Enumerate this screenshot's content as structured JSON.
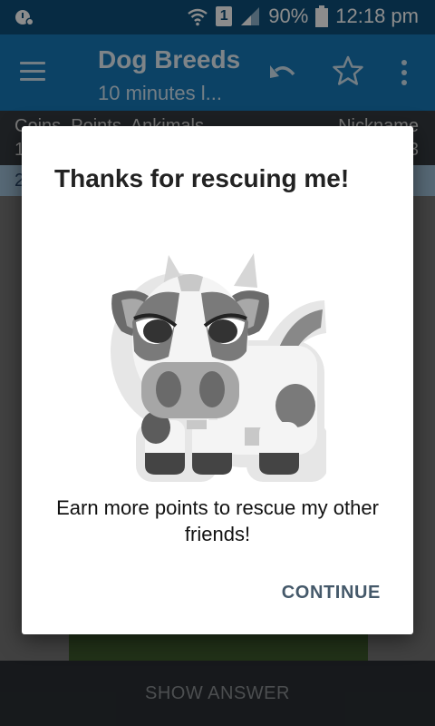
{
  "status_bar": {
    "battery": "90%",
    "time": "12:18 pm",
    "sim_badge": "1"
  },
  "app_bar": {
    "title": "Dog Breeds",
    "subtitle": "10 minutes l..."
  },
  "info_strip": {
    "left_line1": "Coins, Points, Ankimals",
    "left_line2": "1",
    "right_line1": "Nickname",
    "right_line2": "3"
  },
  "row_strip": {
    "text": "2"
  },
  "dialog": {
    "title": "Thanks for rescuing me!",
    "message": "Earn more points to rescue my other friends!",
    "continue_label": "CONTINUE"
  },
  "bottom_bar": {
    "show_answer_label": "SHOW ANSWER"
  },
  "colors": {
    "status_bar": "#0e4f7a",
    "app_bar": "#1779b8",
    "accent_button_text": "#45596a"
  },
  "icons": [
    "notification-icon",
    "wifi-icon",
    "sim-icon",
    "signal-icon",
    "battery-icon",
    "menu-icon",
    "undo-icon",
    "star-icon",
    "more-vert-icon",
    "cow-illustration"
  ]
}
